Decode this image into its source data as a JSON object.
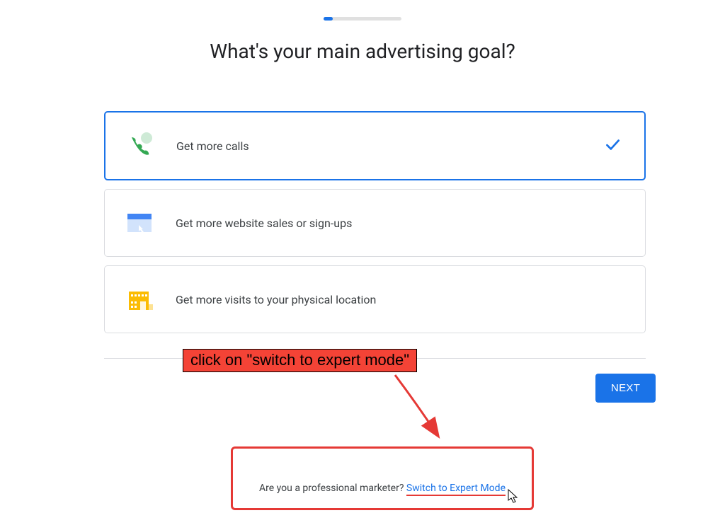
{
  "title": "What's your main advertising goal?",
  "options": [
    {
      "label": "Get more calls",
      "selected": true,
      "icon": "phone"
    },
    {
      "label": "Get more website sales or sign-ups",
      "selected": false,
      "icon": "browser"
    },
    {
      "label": "Get more visits to your physical location",
      "selected": false,
      "icon": "store"
    }
  ],
  "buttons": {
    "next": "NEXT"
  },
  "footer": {
    "question": "Are you a professional marketer? ",
    "link": "Switch to Expert Mode"
  },
  "annotation": "click on \"switch to expert mode\""
}
